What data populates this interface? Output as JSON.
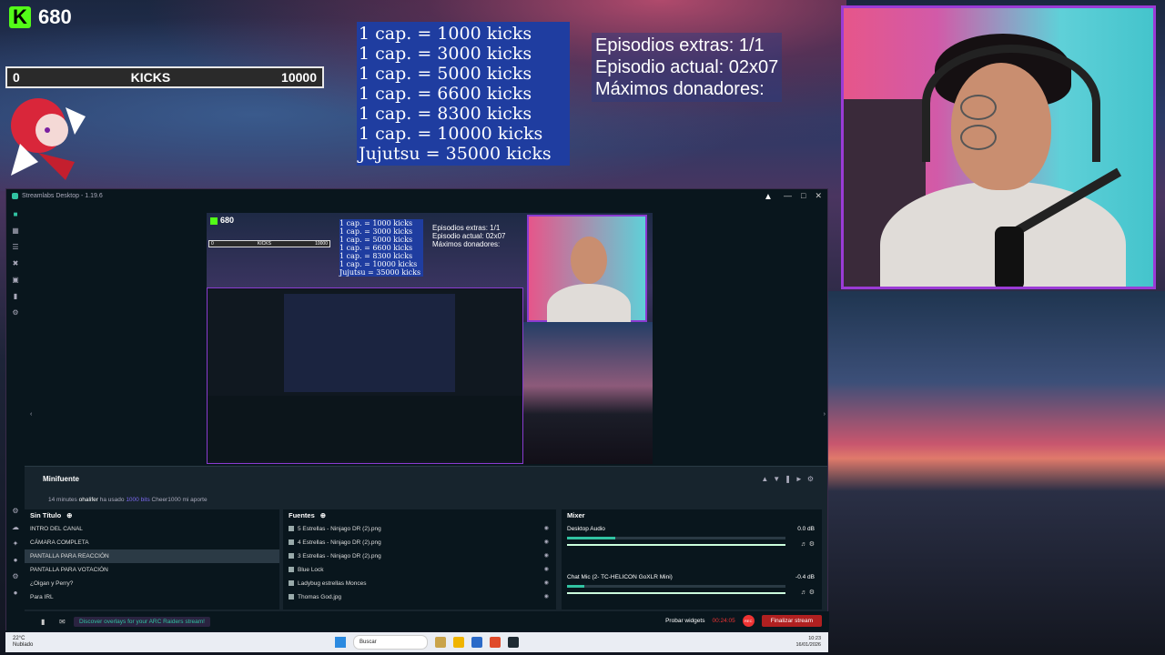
{
  "overlay": {
    "kick_count": "680",
    "kick_bar": {
      "min": "0",
      "label": "KICKS",
      "max": "10000"
    },
    "caps": [
      "1 cap. = 1000 kicks",
      "1 cap. = 3000 kicks",
      "1 cap. = 5000 kicks",
      "1 cap. = 6600 kicks",
      "1 cap. = 8300 kicks",
      "1 cap. = 10000 kicks",
      "Jujutsu = 35000 kicks"
    ],
    "episodes": [
      "Episodios extras: 1/1",
      "Episodio actual: 02x07",
      "Máximos donadores:"
    ]
  },
  "app": {
    "title": "Streamlabs Desktop - 1.19.6",
    "colors": {
      "accent": "#31c3a2",
      "kick_green": "#53fc18",
      "frame_purple": "#9b3bd6"
    },
    "minifuente": {
      "title": "Minifuente",
      "chat": {
        "time": "14 minutes",
        "user": "ohalifer",
        "action": "ha usado",
        "bits": "1000 bits",
        "message": "Cheer1000 mi aporte"
      }
    },
    "scenes": {
      "title": "Sin Título",
      "items": [
        {
          "label": "INTRO DEL CANAL",
          "selected": false
        },
        {
          "label": "CÁMARA COMPLETA",
          "selected": false
        },
        {
          "label": "PANTALLA PARA REACCIÓN",
          "selected": true
        },
        {
          "label": "PANTALLA PARA VOTACIÓN",
          "selected": false
        },
        {
          "label": "¿Oigan y Perry?",
          "selected": false
        },
        {
          "label": "Para IRL",
          "selected": false
        }
      ]
    },
    "sources": {
      "title": "Fuentes",
      "items": [
        "5 Estrellas - Ninjago DR (2).png",
        "4 Estrellas - Ninjago DR (2).png",
        "3 Estrellas - Ninjago DR (2).png",
        "Blue Lock",
        "Ladybug estrellas Monces",
        "Thomas God.jpg"
      ]
    },
    "mixer": {
      "title": "Mixer",
      "channels": [
        {
          "name": "Desktop Audio",
          "db": "0.0 dB",
          "level": 0.22
        },
        {
          "name": "Chat Mic (2- TC-HELICON GoXLR Mini)",
          "db": "-0.4 dB",
          "level": 0.08
        }
      ]
    },
    "footer": {
      "promo": "Discover overlays for your ARC Raiders stream!",
      "test_widgets": "Probar widgets",
      "time": "00:24:05",
      "rec": "REC",
      "end_stream": "Finalizar stream"
    }
  },
  "taskbar": {
    "temp": "22°C",
    "weather": "Nublado",
    "search": "Buscar",
    "time": "10:23",
    "date": "16/01/2026"
  }
}
